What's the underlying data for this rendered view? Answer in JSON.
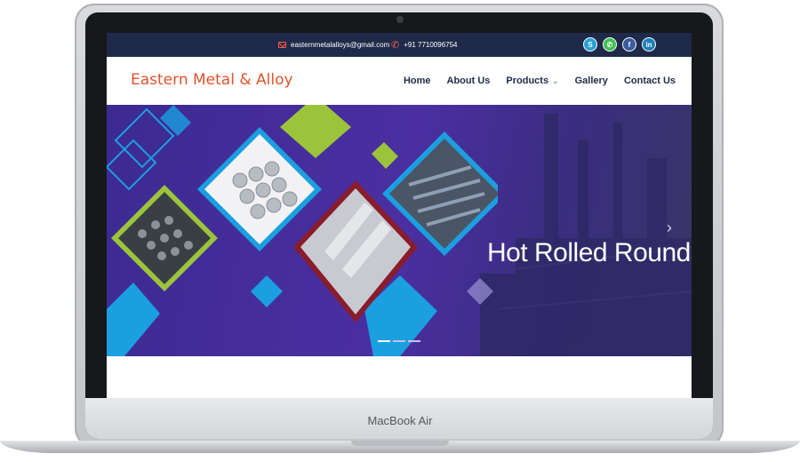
{
  "device": {
    "brand_label": "MacBook Air"
  },
  "topbar": {
    "email": "easternmetalalloys@gmail.com",
    "phone": "+91 7710096754",
    "social_icons": [
      "skype-icon",
      "whatsapp-icon",
      "facebook-icon",
      "linkedin-icon"
    ]
  },
  "navbar": {
    "logo": "Eastern Metal & Alloy",
    "items": [
      {
        "label": "Home"
      },
      {
        "label": "About Us"
      },
      {
        "label": "Products"
      },
      {
        "label": "Gallery"
      },
      {
        "label": "Contact Us"
      }
    ]
  },
  "hero": {
    "title": "Hot Rolled Rounds",
    "slides": 3,
    "active_slide": 1
  },
  "colors": {
    "topbar_bg": "#1f2a4a",
    "logo": "#e0532a",
    "nav_text": "#1f2a4a",
    "hero_bg": "#4b2fa2",
    "accent_green": "#9cc43a",
    "accent_blue": "#1b9fe0",
    "accent_red": "#8a1c2b"
  }
}
